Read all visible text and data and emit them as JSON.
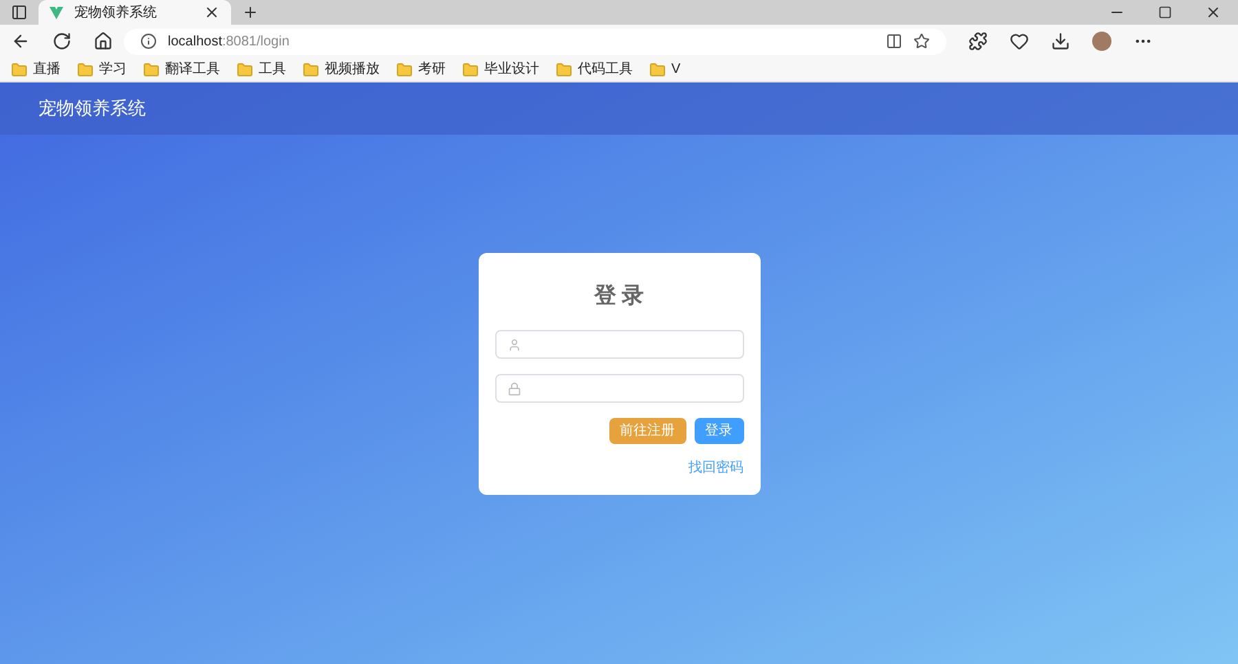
{
  "browser": {
    "tab_title": "宠物领养系统",
    "url_host": "localhost",
    "url_path": ":8081/login",
    "bookmarks": [
      "直播",
      "学习",
      "翻译工具",
      "工具",
      "视频播放",
      "考研",
      "毕业设计",
      "代码工具",
      "V"
    ]
  },
  "header": {
    "title": "宠物领养系统"
  },
  "login": {
    "title": "登 录",
    "fields": [
      {
        "kind": "username"
      },
      {
        "kind": "password"
      }
    ],
    "buttons": [
      {
        "label": "前往注册",
        "kind": "register"
      },
      {
        "label": "登录",
        "kind": "login"
      }
    ],
    "link": "找回密码"
  }
}
